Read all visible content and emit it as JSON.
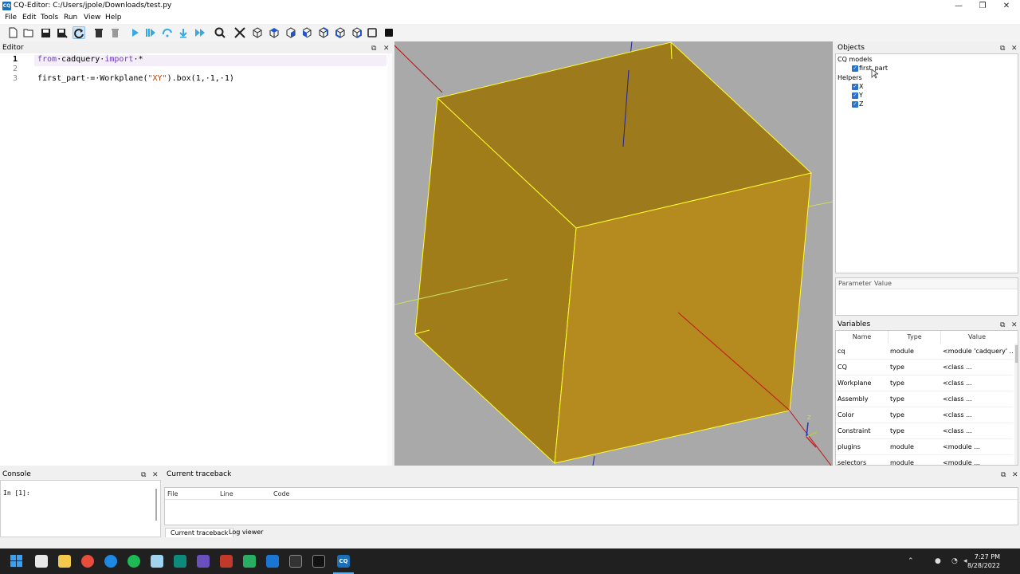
{
  "window": {
    "icon_text": "CQ",
    "title": "CQ-Editor: C:/Users/jpole/Downloads/test.py",
    "minimize": "—",
    "maximize": "❐",
    "close": "✕"
  },
  "menu": [
    "File",
    "Edit",
    "Tools",
    "Run",
    "View",
    "Help"
  ],
  "editor": {
    "title": "Editor",
    "lines": [
      {
        "num": "1",
        "parts": [
          [
            "kw",
            "from"
          ],
          [
            "",
            "·cadquery·"
          ],
          [
            "kw",
            "import"
          ],
          [
            "",
            "·*"
          ]
        ]
      },
      {
        "num": "2",
        "parts": []
      },
      {
        "num": "3",
        "parts": [
          [
            "",
            "first_part·=·Workplane("
          ],
          [
            "str",
            "\"XY\""
          ],
          [
            "",
            ").box(1,·1,·1)"
          ]
        ]
      }
    ]
  },
  "panel_buttons": {
    "float": "⧉",
    "close": "✕"
  },
  "objects": {
    "title": "Objects",
    "groups": [
      {
        "label": "CQ models",
        "items": [
          "first_part"
        ]
      },
      {
        "label": "Helpers",
        "items": [
          "X",
          "Y",
          "Z"
        ]
      }
    ]
  },
  "params": {
    "col_param": "Parameter",
    "col_value": "Value"
  },
  "variables": {
    "title": "Variables",
    "columns": [
      "Name",
      "Type",
      "Value"
    ],
    "rows": [
      [
        "cq",
        "module",
        "<module 'cadquery' ..."
      ],
      [
        "CQ",
        "type",
        "<class ..."
      ],
      [
        "Workplane",
        "type",
        "<class ..."
      ],
      [
        "Assembly",
        "type",
        "<class ..."
      ],
      [
        "Color",
        "type",
        "<class ..."
      ],
      [
        "Constraint",
        "type",
        "<class ..."
      ],
      [
        "plugins",
        "module",
        "<module ..."
      ],
      [
        "selectors",
        "module",
        "<module ..."
      ]
    ]
  },
  "console": {
    "title": "Console",
    "prompt": "In [1]:"
  },
  "traceback": {
    "title": "Current traceback",
    "columns": [
      "File",
      "Line",
      "Code"
    ],
    "tabs": [
      "Current traceback",
      "Log viewer"
    ]
  },
  "taskbar": {
    "time": "7:27 PM",
    "date": "8/28/2022"
  },
  "colors": {
    "cube_top": "#9d7a1c",
    "cube_left": "#a07d18",
    "cube_right": "#b58a1e",
    "edge": "#ffff30",
    "viewport": "#a9a9a9"
  }
}
